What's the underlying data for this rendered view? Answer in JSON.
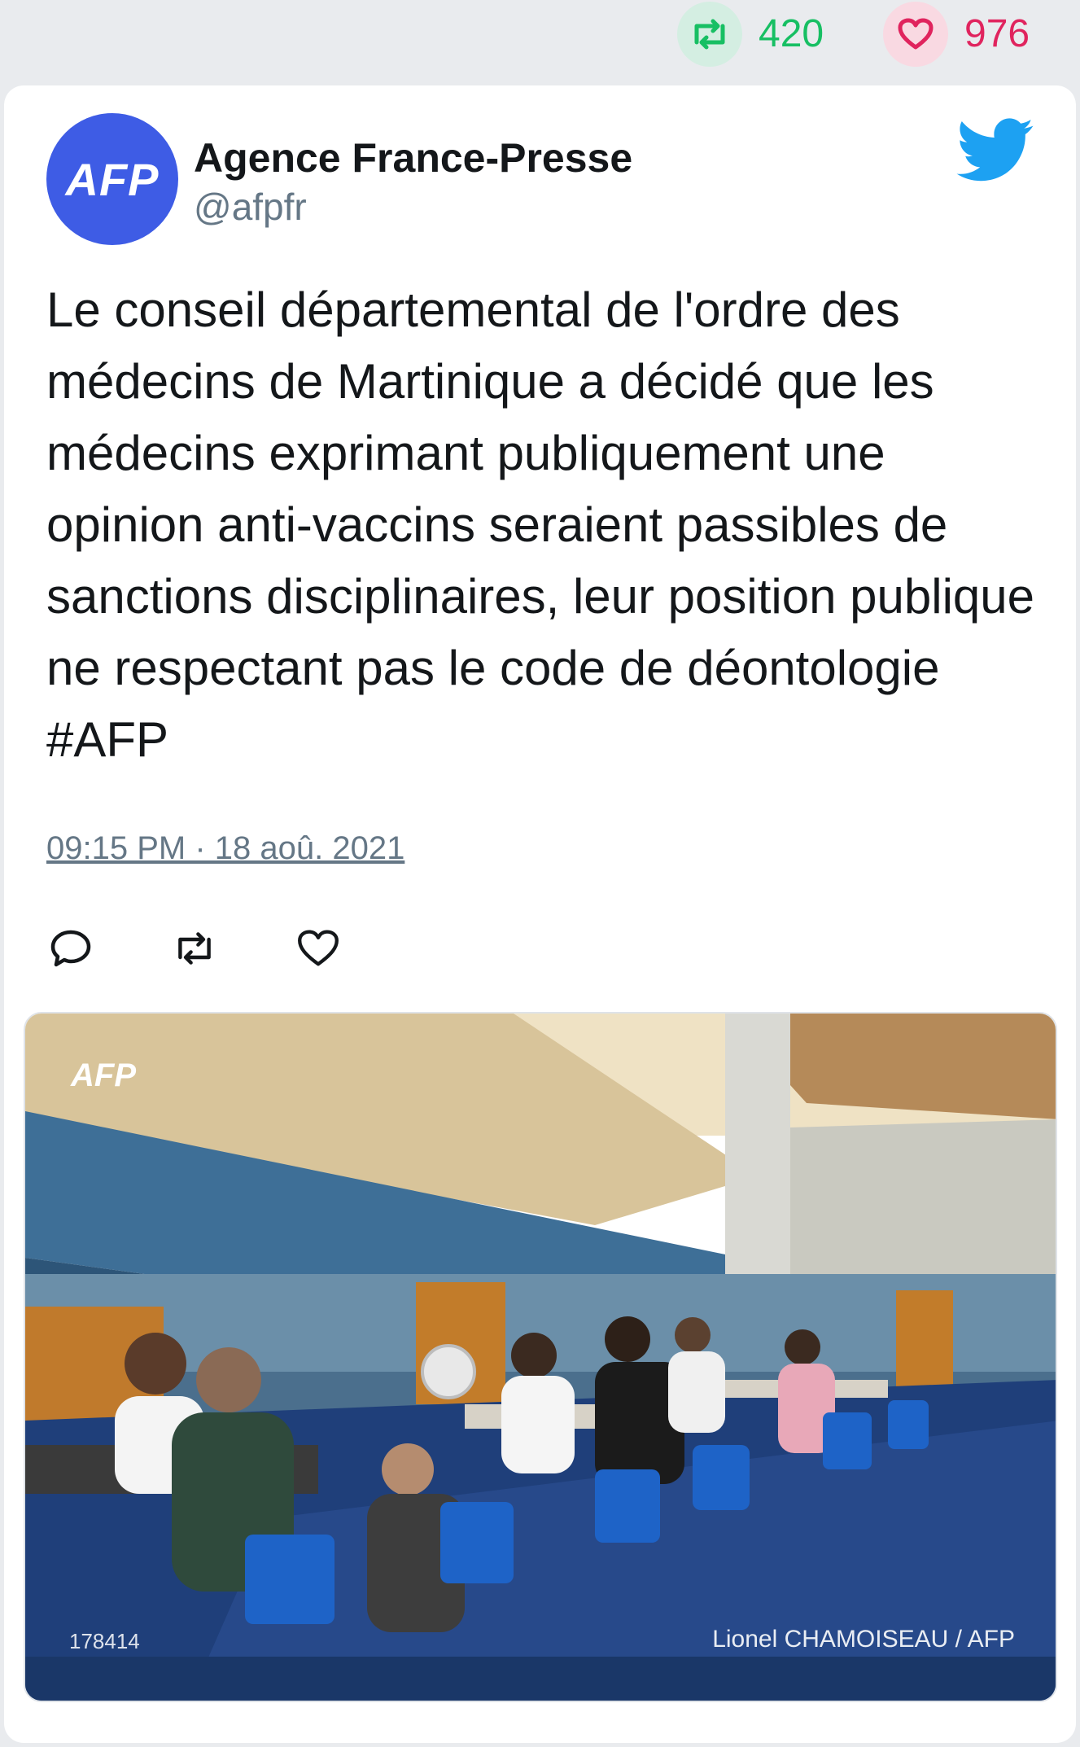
{
  "stats": {
    "retweets": "420",
    "likes": "976",
    "retweet_color": "#17bf63",
    "like_color": "#e0245e"
  },
  "author": {
    "avatar_text": "AFP",
    "name": "Agence France-Presse",
    "handle": "@afpfr"
  },
  "tweet": {
    "text": "Le conseil départemental de l'ordre des médecins de Martinique a décidé que les médecins exprimant publiquement une opinion anti-vaccins seraient passibles de sanctions disciplinaires, leur position publique ne respectant pas le code de déontologie #AFP",
    "timestamp": "09:15 PM · 18 aoû. 2021"
  },
  "actions": [
    {
      "icon": "reply-icon"
    },
    {
      "icon": "retweet-icon"
    },
    {
      "icon": "like-icon"
    }
  ],
  "photo": {
    "logo_text": "AFP",
    "photo_id": "178414",
    "credit": "Lionel CHAMOISEAU / AFP"
  },
  "colors": {
    "brand_blue": "#3e5ce5",
    "twitter_blue": "#1da1f2",
    "muted_text": "#657786",
    "background": "#e9ebee"
  }
}
